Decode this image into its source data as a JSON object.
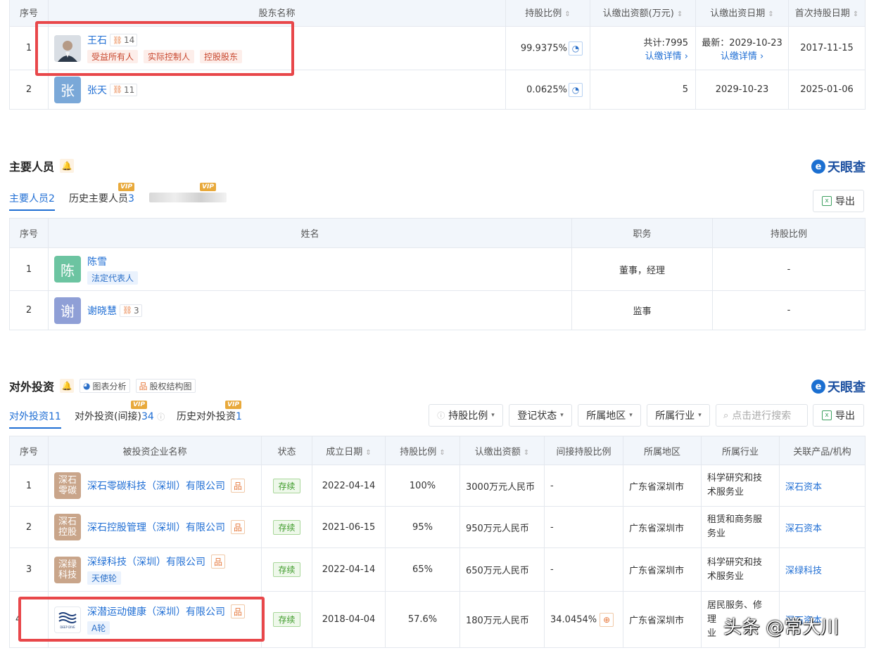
{
  "shareholders": {
    "headers": [
      "序号",
      "股东名称",
      "持股比例",
      "认缴出资额(万元)",
      "认缴出资日期",
      "首次持股日期"
    ],
    "rows": [
      {
        "idx": "1",
        "name": "王石",
        "count": "14",
        "tags": [
          "受益所有人",
          "实际控制人",
          "控股股东"
        ],
        "ratio": "99.9375%",
        "amount": "共计:7995",
        "amount_link": "认缴详情 ›",
        "date": "最新：2029-10-23",
        "date_link": "认缴详情 ›",
        "first_date": "2017-11-15"
      },
      {
        "idx": "2",
        "avatar": "张",
        "name": "张天",
        "count": "11",
        "ratio": "0.0625%",
        "amount": "5",
        "date": "2029-10-23",
        "first_date": "2025-01-06"
      }
    ]
  },
  "personnel": {
    "title": "主要人员",
    "logo": "天眼查",
    "tabs": [
      {
        "label": "主要人员",
        "count": "2"
      },
      {
        "label": "历史主要人员",
        "count": "3"
      }
    ],
    "vip": "VIP",
    "export": "导出",
    "headers": [
      "序号",
      "姓名",
      "职务",
      "持股比例"
    ],
    "rows": [
      {
        "idx": "1",
        "avatar": "陈",
        "name": "陈雪",
        "tag": "法定代表人",
        "role": "董事，经理",
        "ratio": "-"
      },
      {
        "idx": "2",
        "avatar": "谢",
        "name": "谢晓慧",
        "count": "3",
        "role": "监事",
        "ratio": "-"
      }
    ]
  },
  "investment": {
    "title": "对外投资",
    "logo": "天眼查",
    "tools": [
      "图表分析",
      "股权结构图"
    ],
    "tabs": [
      {
        "label": "对外投资",
        "count": "11"
      },
      {
        "label": "对外投资(间接)",
        "count": "34"
      },
      {
        "label": "历史对外投资",
        "count": "1"
      }
    ],
    "vip": "VIP",
    "filters": [
      "持股比例",
      "登记状态",
      "所属地区",
      "所属行业"
    ],
    "search_placeholder": "点击进行搜索",
    "export": "导出",
    "headers": [
      "序号",
      "被投资企业名称",
      "状态",
      "成立日期",
      "持股比例",
      "认缴出资额",
      "间接持股比例",
      "所属地区",
      "所属行业",
      "关联产品/机构"
    ],
    "rows": [
      {
        "idx": "1",
        "logo": [
          "深石",
          "零碳"
        ],
        "name": "深石零碳科技（深圳）有限公司",
        "status": "存续",
        "date": "2022-04-14",
        "ratio": "100%",
        "amount": "3000万元人民币",
        "indirect": "-",
        "region": "广东省深圳市",
        "industry": [
          "科学研究和技",
          "术服务业"
        ],
        "product": "深石资本"
      },
      {
        "idx": "2",
        "logo": [
          "深石",
          "控股"
        ],
        "name": "深石控股管理（深圳）有限公司",
        "status": "存续",
        "date": "2021-06-15",
        "ratio": "95%",
        "amount": "950万元人民币",
        "indirect": "-",
        "region": "广东省深圳市",
        "industry": [
          "租赁和商务服",
          "务业"
        ],
        "product": "深石资本"
      },
      {
        "idx": "3",
        "logo": [
          "深绿",
          "科技"
        ],
        "name": "深绿科技（深圳）有限公司",
        "tag": "天使轮",
        "status": "存续",
        "date": "2022-04-14",
        "ratio": "65%",
        "amount": "650万元人民币",
        "indirect": "-",
        "region": "广东省深圳市",
        "industry": [
          "科学研究和技",
          "术服务业"
        ],
        "product": "深绿科技"
      },
      {
        "idx": "4",
        "logo_text": "DEEP DIVE",
        "name": "深潜运动健康（深圳）有限公司",
        "tag": "A轮",
        "status": "存续",
        "date": "2018-04-04",
        "ratio": "57.6%",
        "amount": "180万元人民币",
        "indirect": "34.0454%",
        "region": "广东省深圳市",
        "industry": [
          "居民服务、修",
          "理",
          "业"
        ],
        "product": "深石资本"
      }
    ]
  },
  "watermark": "头条 @常大川",
  "colors": {
    "link": "#1f6ed4",
    "highlight": "#e8474a",
    "status_green": "#3f9b2b",
    "vip": "#e8a93b"
  }
}
